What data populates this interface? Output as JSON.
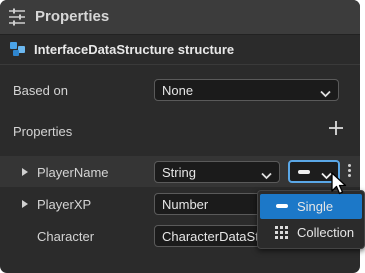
{
  "header": {
    "title": "Properties",
    "icon": "sliders-icon"
  },
  "structure": {
    "label": "InterfaceDataStructure structure",
    "icon": "structure-icon"
  },
  "based_on": {
    "label": "Based on",
    "value": "None"
  },
  "properties_section": {
    "label": "Properties",
    "add_icon": "plus-icon"
  },
  "properties": [
    {
      "name": "PlayerName",
      "type": "String"
    },
    {
      "name": "PlayerXP",
      "type": "Number"
    },
    {
      "name": "Character",
      "type": "CharacterDataSt"
    }
  ],
  "container_menu": {
    "items": [
      {
        "label": "Single",
        "icon": "single-icon",
        "selected": true
      },
      {
        "label": "Collection",
        "icon": "grid-icon",
        "selected": false
      }
    ]
  },
  "colors": {
    "accent": "#1c78c8",
    "focus_border": "#5aa7e6"
  }
}
